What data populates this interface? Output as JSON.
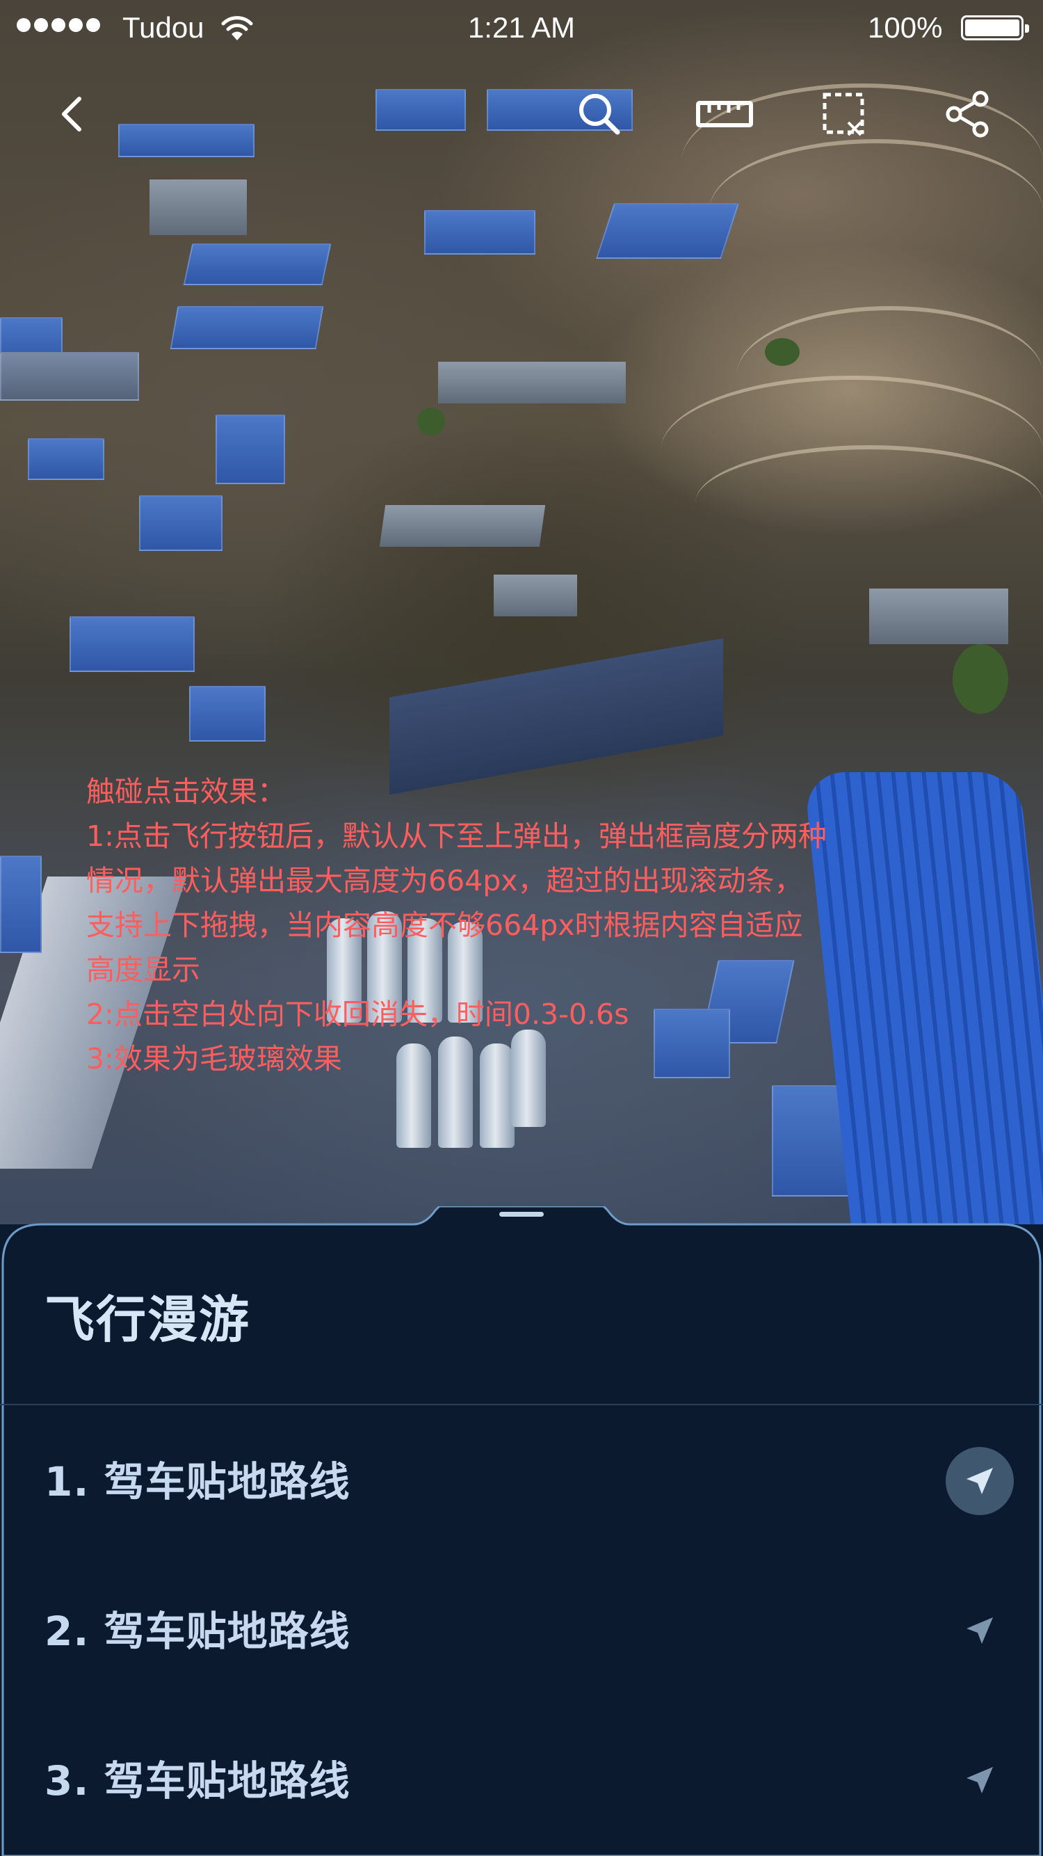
{
  "status_bar": {
    "carrier": "Tudou",
    "time": "1:21 AM",
    "battery": "100%",
    "signal_bars": 5
  },
  "toolbar": {
    "back_icon": "chevron-left-icon",
    "search_icon": "search-icon",
    "measure_icon": "ruler-icon",
    "crop_icon": "dashed-select-icon",
    "share_icon": "share-icon"
  },
  "annotation": {
    "color": "#ff5e5e",
    "lines": [
      "触碰点击效果：",
      "1:点击飞行按钮后，默认从下至上弹出，弹出框高度分两种",
      "情况，默认弹出最大高度为664px，超过的出现滚动条，",
      "支持上下拖拽，当内容高度不够664px时根据内容自适应",
      "高度显示",
      "2:点击空白处向下收回消失，时间0.3-0.6s",
      "3:效果为毛玻璃效果"
    ]
  },
  "sheet": {
    "title": "飞行漫游",
    "accent": "#6d9cc7",
    "routes": [
      {
        "label": "1. 驾车贴地路线",
        "active": true
      },
      {
        "label": "2. 驾车贴地路线",
        "active": false
      },
      {
        "label": "3. 驾车贴地路线",
        "active": false
      }
    ]
  }
}
